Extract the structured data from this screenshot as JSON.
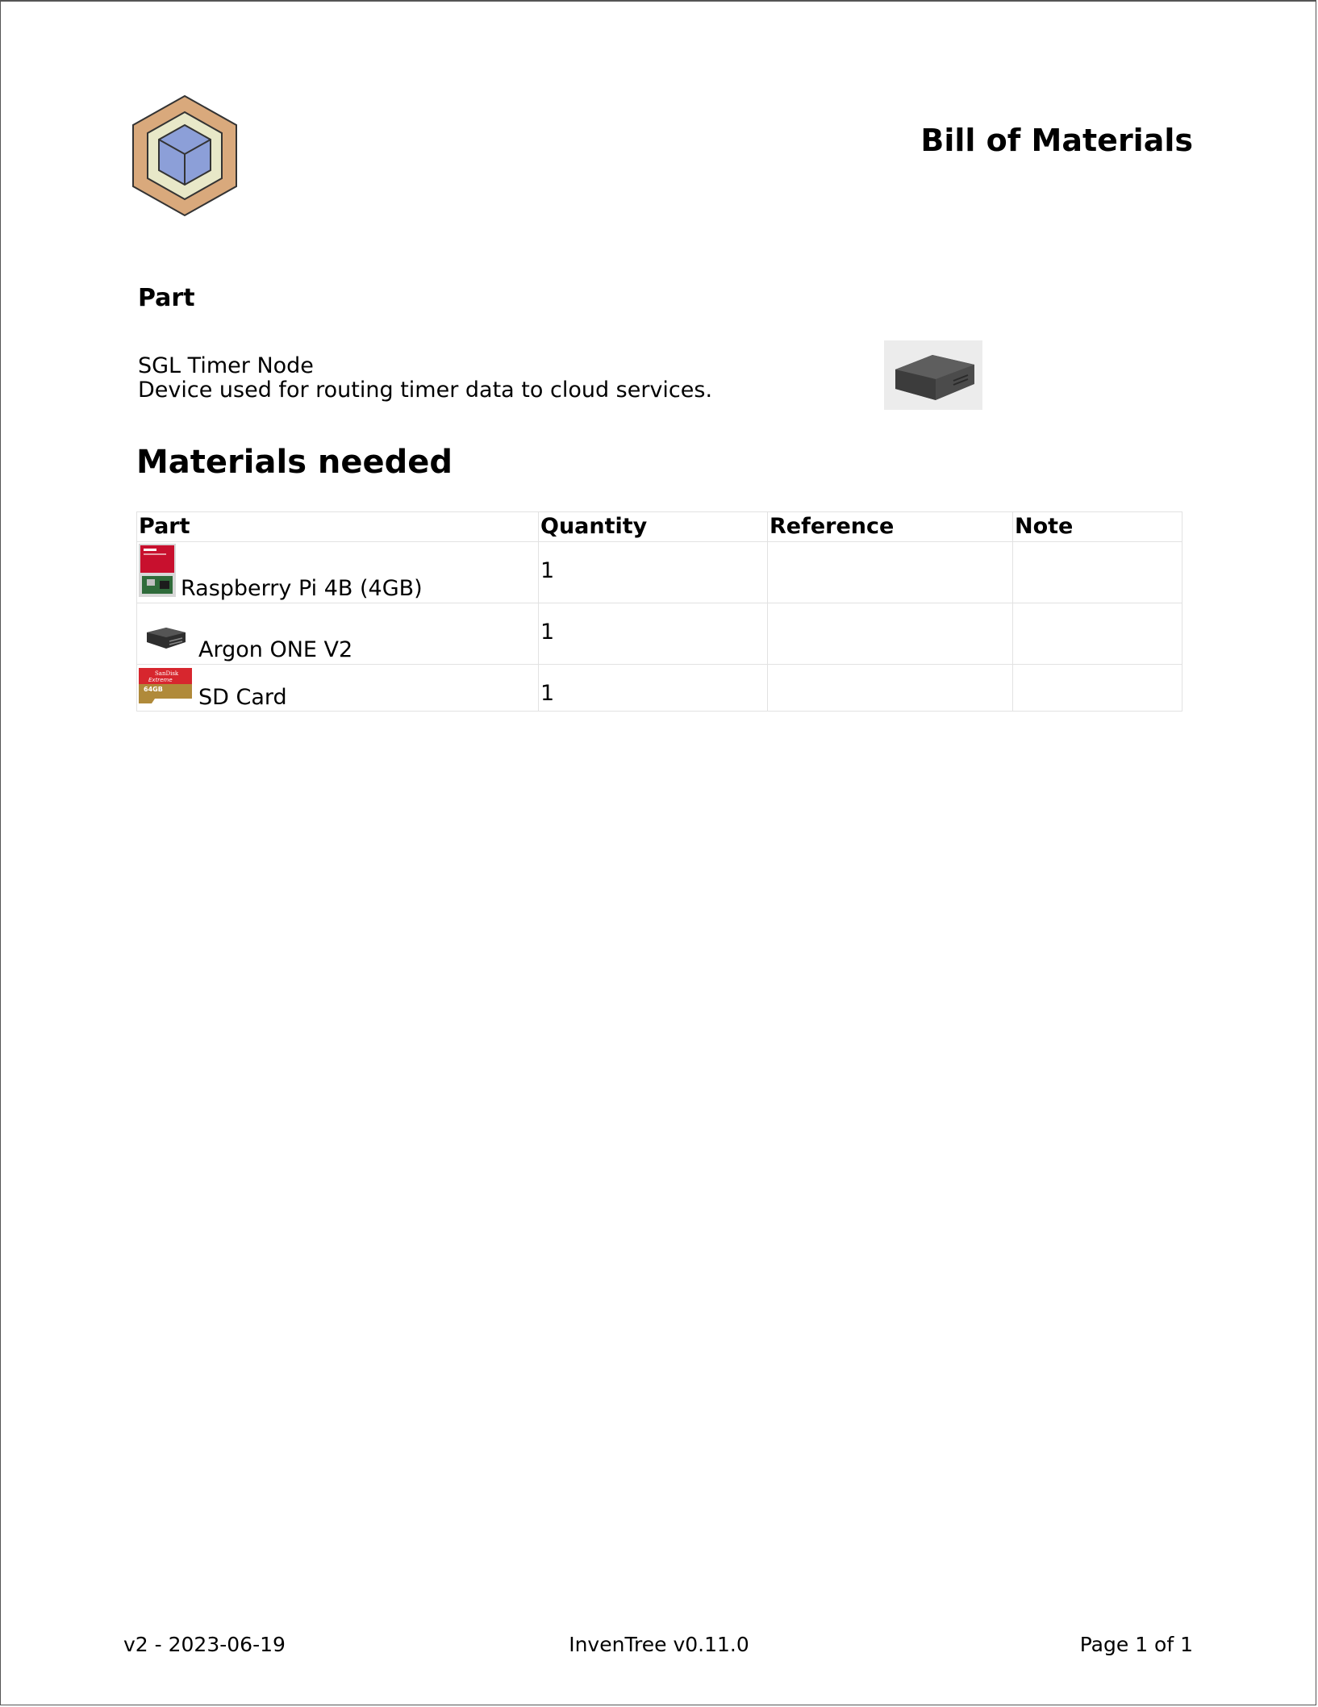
{
  "header": {
    "logo_icon": "inventree-hexagon-cube-logo",
    "title": "Bill of Materials"
  },
  "part_section": {
    "heading": "Part",
    "name": "SGL Timer Node",
    "description": "Device used for routing timer data to cloud services.",
    "image_icon": "case-photo"
  },
  "materials": {
    "heading": "Materials needed",
    "columns": [
      "Part",
      "Quantity",
      "Reference",
      "Note"
    ],
    "rows": [
      {
        "part": "Raspberry Pi 4B (4GB)",
        "quantity": "1",
        "reference": "",
        "note": "",
        "thumb_icon": "raspberry-pi-box-photo"
      },
      {
        "part": "Argon ONE V2",
        "quantity": "1",
        "reference": "",
        "note": "",
        "thumb_icon": "case-photo"
      },
      {
        "part": "SD Card",
        "quantity": "1",
        "reference": "",
        "note": "",
        "thumb_icon": "sandisk-sd-card-photo"
      }
    ]
  },
  "sd_card_label": {
    "brand": "SanDisk",
    "line": "Extreme",
    "capacity": "64GB"
  },
  "footer": {
    "version_date": "v2 - 2023-06-19",
    "app_version": "InvenTree v0.11.0",
    "page_info": "Page 1 of 1"
  },
  "colors": {
    "logo_outer": "#d9a97c",
    "logo_inner": "#e8e8c8",
    "logo_cube": "#8c9fd8",
    "table_border": "#e2e2e2"
  }
}
